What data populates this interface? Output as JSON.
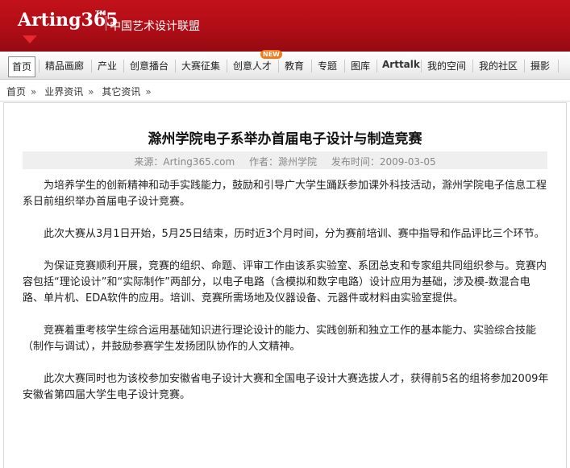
{
  "header": {
    "logo_text": "Arting365",
    "logo_tm": "TM",
    "logo_subtitle": "中国艺术设计联盟"
  },
  "nav": {
    "items": [
      {
        "label": "首页",
        "active": true
      },
      {
        "label": "精品画廊"
      },
      {
        "label": "产业"
      },
      {
        "label": "创意播台"
      },
      {
        "label": "大赛征集"
      },
      {
        "label": "创意人才",
        "badge": "NEW"
      },
      {
        "label": "教育"
      },
      {
        "label": "专题"
      },
      {
        "label": "图库"
      },
      {
        "label": "Arttalk"
      },
      {
        "label": "我的空间"
      },
      {
        "label": "我的社区"
      },
      {
        "label": "摄影"
      }
    ]
  },
  "breadcrumb": {
    "items": [
      "首页",
      "业界资讯",
      "其它资讯"
    ],
    "separator": "»"
  },
  "article": {
    "title": "滁州学院电子系举办首届电子设计与制造竞赛",
    "source_label": "来源：Arting365.com",
    "author_label": "作者：滁州学院",
    "date_label": "发布时间：2009-03-05",
    "paragraphs": [
      "为培养学生的创新精神和动手实践能力，鼓励和引导广大学生踊跃参加课外科技活动，滁州学院电子信息工程系日前组织举办首届电子设计竞赛。",
      "此次大赛从3月1日开始，5月25日结束，历时近3个月时间，分为赛前培训、赛中指导和作品评比三个环节。",
      "为保证竞赛顺利开展，竞赛的组织、命题、评审工作由该系实验室、系团总支和专家组共同组织参与。竞赛内容包括“理论设计”和“实际制作”两部分，以电子电路（含模拟和数字电路）设计应用为基础，涉及模-数混合电路、单片机、EDA软件的应用。培训、竞赛所需场地及仪器设备、元器件或材料由实验室提供。",
      "竞赛着重考核学生综合运用基础知识进行理论设计的能力、实践创新和独立工作的基本能力、实验综合技能（制作与调试），并鼓励参赛学生发扬团队协作的人文精神。",
      "此次大赛同时也为该校参加安徽省电子设计大赛和全国电子设计大赛选拔人才，获得前5名的组将参加2009年安徽省第四届大学生电子设计竞赛。"
    ]
  },
  "colors": {
    "header_red": "#b00d16",
    "badge_orange": "#f07a1c",
    "meta_gray": "#888888"
  }
}
